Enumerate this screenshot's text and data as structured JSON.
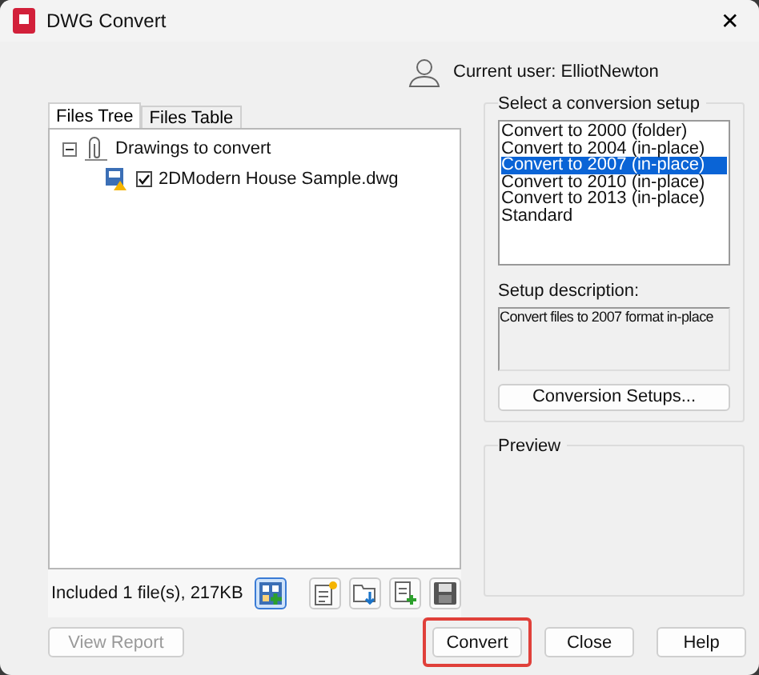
{
  "window": {
    "title": "DWG Convert",
    "close": "✕"
  },
  "user": {
    "label": "Current user: ElliotNewton"
  },
  "tabs": [
    {
      "label": "Files Tree",
      "selected": true
    },
    {
      "label": "Files Table",
      "selected": false
    }
  ],
  "tree": {
    "label": "Drawings to convert",
    "expanded": true,
    "children": [
      {
        "label": "2DModern House Sample.dwg",
        "checked": true
      }
    ]
  },
  "summary": "Included 1 file(s), 217KB",
  "toolbar": [
    {
      "kind": "grid",
      "selected": true
    },
    {
      "kind": "new",
      "selected": false
    },
    {
      "kind": "folder",
      "selected": false
    },
    {
      "kind": "add",
      "selected": false
    },
    {
      "kind": "save",
      "selected": false
    }
  ],
  "setup": {
    "title": "Select a conversion setup",
    "items": [
      {
        "label": "Convert to 2000 (folder)",
        "selected": false
      },
      {
        "label": "Convert to 2004 (in-place)",
        "selected": false
      },
      {
        "label": "Convert to 2007 (in-place)",
        "selected": true
      },
      {
        "label": "Convert to 2010 (in-place)",
        "selected": false
      },
      {
        "label": "Convert to 2013 (in-place)",
        "selected": false
      },
      {
        "label": "Standard",
        "selected": false
      }
    ],
    "description_label": "Setup description:",
    "description": "Convert files to 2007 format in-place",
    "button": "Conversion Setups..."
  },
  "preview": {
    "title": "Preview"
  },
  "buttons": [
    {
      "label": "View Report",
      "disabled": true,
      "highlighted": false
    },
    {
      "label": "Convert",
      "disabled": false,
      "highlighted": true
    },
    {
      "label": "Close",
      "disabled": false,
      "highlighted": false
    },
    {
      "label": "Help",
      "disabled": false,
      "highlighted": false
    }
  ]
}
